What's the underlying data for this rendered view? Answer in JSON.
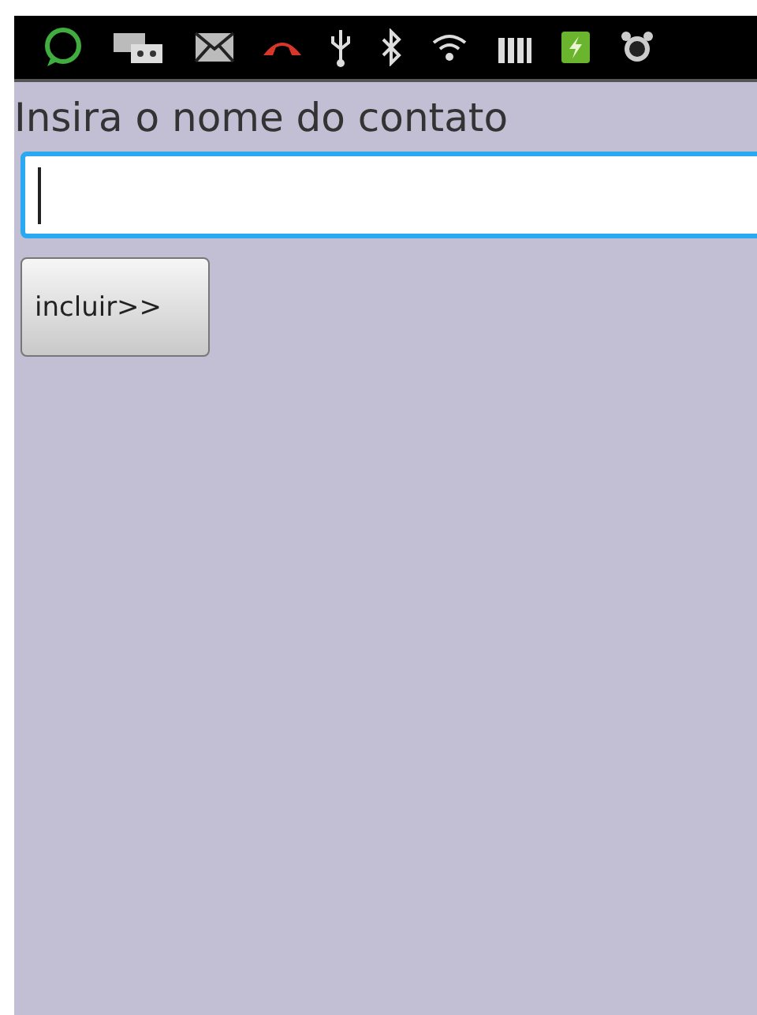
{
  "label": "Insira o nome do contato",
  "name_field": {
    "focused": true
  },
  "add_button": "incluir>>"
}
